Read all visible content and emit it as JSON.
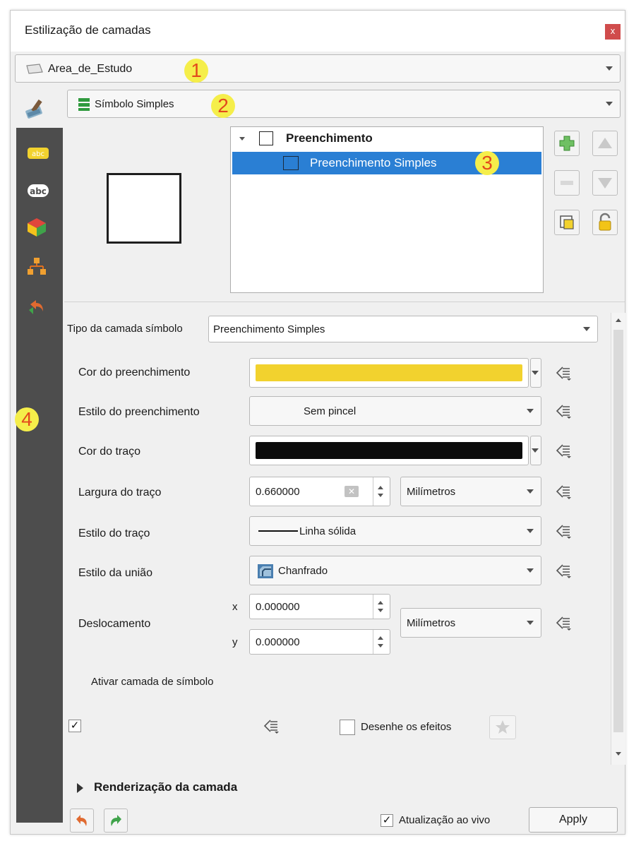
{
  "window": {
    "title": "Estilização de camadas",
    "close_label": "x"
  },
  "layer_combo": {
    "value": "Area_de_Estudo",
    "icon": "polygon-layer-icon"
  },
  "renderer_combo": {
    "value": "Símbolo Simples",
    "icon": "single-symbol-icon"
  },
  "markers": {
    "m1": "1",
    "m2": "2",
    "m3": "3",
    "m4": "4"
  },
  "sidebar": {
    "icons": [
      "paintbrush-icon",
      "labels-icon",
      "abc-icon",
      "3d-cube-icon",
      "diagram-icon",
      "history-icon"
    ]
  },
  "symbol_tree": {
    "root_label": "Preenchimento",
    "child_label": "Preenchimento Simples"
  },
  "tree_buttons": {
    "add": "plus-icon",
    "remove": "minus-icon",
    "up": "arrow-up-icon",
    "down": "arrow-down-icon",
    "duplicate": "duplicate-icon",
    "lock": "lock-icon"
  },
  "properties": {
    "symbol_type_label": "Tipo da camada símbolo",
    "symbol_type_value": "Preenchimento Simples",
    "fill_color_label": "Cor do preenchimento",
    "fill_color": "#f2d22e",
    "fill_style_label": "Estilo do preenchimento",
    "fill_style_value": "Sem pincel",
    "stroke_color_label": "Cor do traço",
    "stroke_color": "#0b0b0b",
    "stroke_width_label": "Largura do traço",
    "stroke_width_value": "0.660000",
    "stroke_width_unit": "Milímetros",
    "stroke_style_label": "Estilo do traço",
    "stroke_style_value": "Linha sólida",
    "join_style_label": "Estilo da união",
    "join_style_value": "Chanfrado",
    "offset_label": "Deslocamento",
    "offset_x_label": "x",
    "offset_x_value": "0.000000",
    "offset_y_label": "y",
    "offset_y_value": "0.000000",
    "offset_unit": "Milímetros",
    "enable_layer_label": "Ativar camada de símbolo",
    "enable_layer_checked": "✓",
    "draw_effects_label": "Desenhe os efeitos"
  },
  "render_section": {
    "label": "Renderização da camada"
  },
  "footer": {
    "live_update_label": "Atualização ao vivo",
    "live_update_checked": "✓",
    "apply_label": "Apply"
  },
  "colors": {
    "accent": "#2a7fd4",
    "sidebar": "#4d4d4d",
    "marker": "#f5ee4a"
  }
}
